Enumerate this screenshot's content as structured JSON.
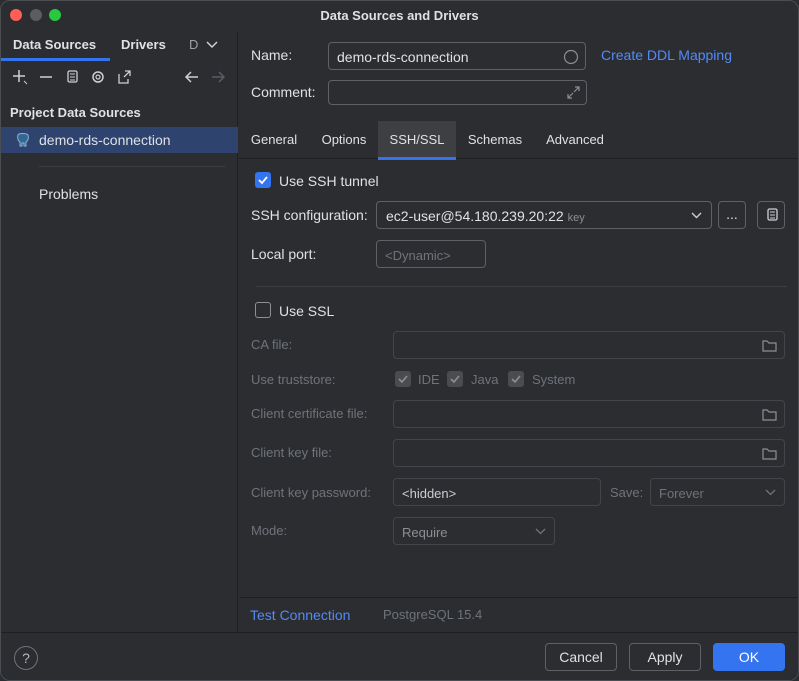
{
  "window": {
    "title": "Data Sources and Drivers"
  },
  "left": {
    "tabs": [
      "Data Sources",
      "Drivers",
      "D"
    ],
    "section_title": "Project Data Sources",
    "items": [
      {
        "label": "demo-rds-connection",
        "icon": "postgresql-elephant-icon"
      }
    ],
    "problems_label": "Problems"
  },
  "form": {
    "name_label": "Name:",
    "name_value": "demo-rds-connection",
    "comment_label": "Comment:",
    "create_ddl_link": "Create DDL Mapping"
  },
  "tabs": [
    "General",
    "Options",
    "SSH/SSL",
    "Schemas",
    "Advanced"
  ],
  "active_tab": "SSH/SSL",
  "ssh": {
    "use_tunnel_label": "Use SSH tunnel",
    "use_tunnel_checked": true,
    "config_label": "SSH configuration:",
    "config_value": "ec2-user@54.180.239.20:22",
    "config_hint": "key",
    "more_button": "...",
    "local_port_label": "Local port:",
    "local_port_placeholder": "<Dynamic>"
  },
  "ssl": {
    "use_ssl_label": "Use SSL",
    "use_ssl_checked": false,
    "ca_file_label": "CA file:",
    "truststore_label": "Use truststore:",
    "truststore_options": [
      "IDE",
      "Java",
      "System"
    ],
    "client_cert_label": "Client certificate file:",
    "client_key_label": "Client key file:",
    "client_key_password_label": "Client key password:",
    "client_key_password_value": "<hidden>",
    "save_label": "Save:",
    "save_value": "Forever",
    "mode_label": "Mode:",
    "mode_value": "Require"
  },
  "footer": {
    "test_connection": "Test Connection",
    "db_version": "PostgreSQL 15.4"
  },
  "buttons": {
    "help": "?",
    "cancel": "Cancel",
    "apply": "Apply",
    "ok": "OK"
  },
  "colors": {
    "accent": "#3574f0",
    "link": "#548af7",
    "background": "#2b2d30"
  }
}
